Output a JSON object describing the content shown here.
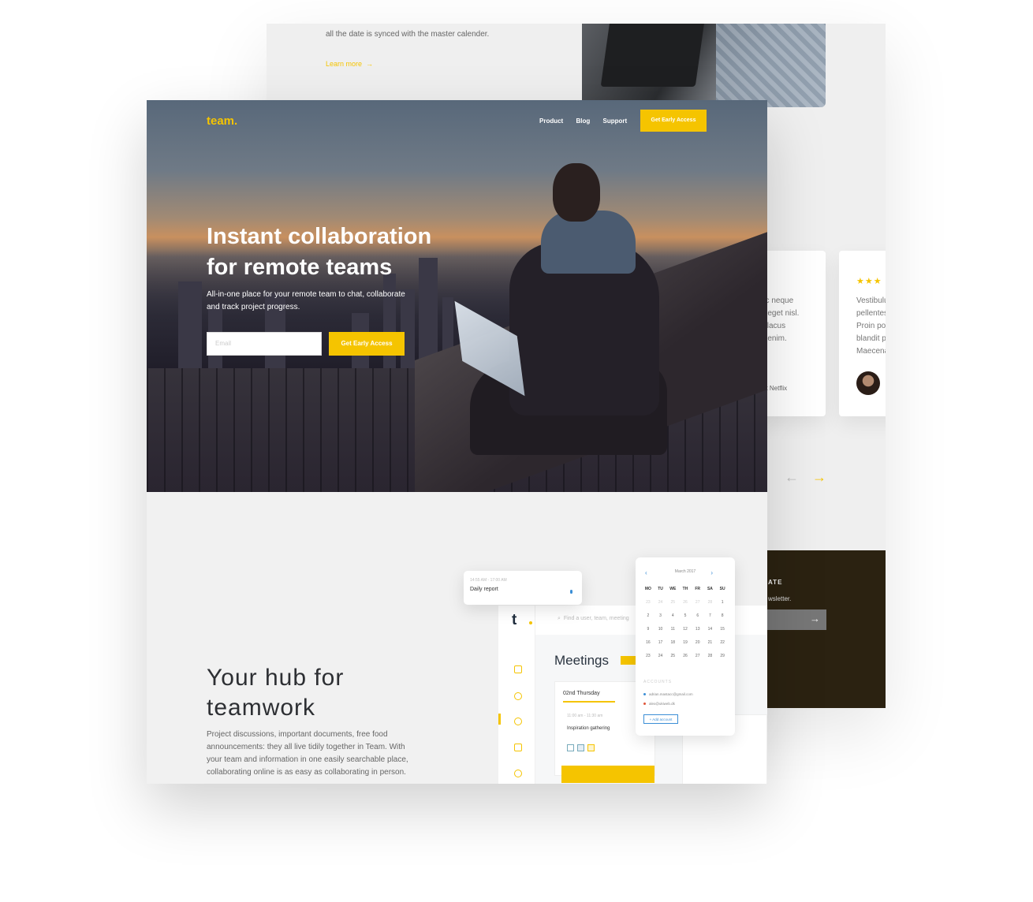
{
  "back": {
    "intro_text": "all the date is synced with the master calender.",
    "learn_more": "Learn more",
    "learn_more_arrow": "→",
    "testimonial1": {
      "lines": [
        "ec neque",
        "d eget nisl.",
        "s lacus",
        "n enim."
      ],
      "author": "ot Netflix"
    },
    "testimonial2": {
      "stars": "★★★",
      "lines": [
        "Vestibulu",
        "pellentes",
        "Proin po",
        "blandit p",
        "Maecena"
      ]
    },
    "arrow_prev": "←",
    "arrow_next": "→",
    "newsletter": {
      "title": "ATE",
      "subtitle": "wsletter.",
      "submit_arrow": "→"
    }
  },
  "header": {
    "logo": "team.",
    "nav": [
      "Product",
      "Blog",
      "Support"
    ],
    "cta": "Get Early Access"
  },
  "hero": {
    "title_line1": "Instant collaboration",
    "title_line2": "for remote teams",
    "subtitle_line1": "All-in-one place for your remote team to chat, collaborate",
    "subtitle_line2": "and track project progress.",
    "email_placeholder": "Email",
    "cta": "Get Early Access"
  },
  "hub": {
    "title_line1": "Your hub for",
    "title_line2": "teamwork",
    "body": [
      "Project discussions, important documents, free food",
      "announcements: they all live tidily together in Team. With",
      "your team and information in one easily searchable place,",
      "collaborating online is as easy as collaborating in person."
    ]
  },
  "mockup": {
    "app_logo": "t",
    "search_placeholder": "Find a user, team, meeting",
    "page_title": "Meetings",
    "day_label": "02nd Thursday",
    "event_time": "11:00 am - 11:30 am",
    "event_title": "Inspiration gathering",
    "report_time": "14:55 AM - 17:00 AM",
    "report_title": "Daily report",
    "calendar": {
      "month": "March 2017",
      "prev": "‹",
      "next": "›",
      "weekdays": [
        "MO",
        "TU",
        "WE",
        "TH",
        "FR",
        "SA",
        "SU"
      ],
      "days": [
        [
          "23",
          "24",
          "25",
          "26",
          "27",
          "28",
          "1"
        ],
        [
          "2",
          "3",
          "4",
          "5",
          "6",
          "7",
          "8"
        ],
        [
          "9",
          "10",
          "11",
          "12",
          "13",
          "14",
          "15"
        ],
        [
          "16",
          "17",
          "18",
          "19",
          "20",
          "21",
          "22"
        ],
        [
          "23",
          "24",
          "25",
          "26",
          "27",
          "28",
          "29"
        ]
      ],
      "accounts_label": "ACCOUNTS",
      "emails": [
        "adrian.mastacc@gmail.com",
        "alex@ukiweb.dk"
      ],
      "add_account": "+ Add account"
    }
  },
  "colors": {
    "accent": "#f5c400",
    "link_blue": "#3b8ed6",
    "dark_panel": "#2b2211"
  }
}
